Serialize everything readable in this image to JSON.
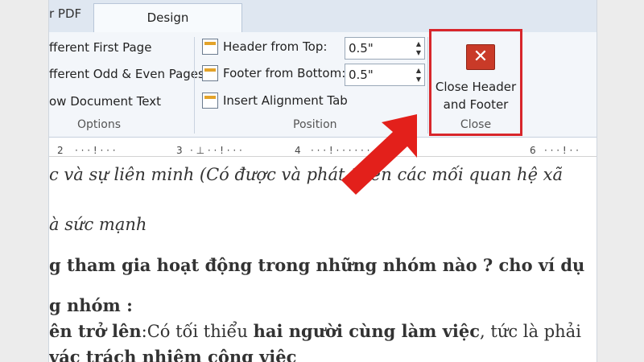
{
  "tabs": {
    "pdf": "r PDF",
    "design": "Design"
  },
  "options": {
    "items": [
      "fferent First Page",
      "fferent Odd & Even Pages",
      "ow Document Text"
    ],
    "label": "Options"
  },
  "position": {
    "header_from_top": "Header from Top:",
    "header_value": "0.5\"",
    "footer_from_bottom": "Footer from Bottom:",
    "footer_value": "0.5\"",
    "insert_alignment_tab": "Insert Alignment Tab",
    "label": "Position"
  },
  "close": {
    "button_line1": "Close Header",
    "button_line2": "and Footer",
    "label": "Close"
  },
  "ruler": [
    "2",
    "3",
    "4",
    "6"
  ],
  "document": {
    "line1": "c và sự liên minh (Có được và phát triển các mối quan hệ xã",
    "line2": "à sức mạnh",
    "line3": "g tham gia hoạt động trong những nhóm nào ? cho ví dụ",
    "line4": "g nhóm :",
    "line5_a": "ên trở lên",
    "line5_b": ":Có tối thiểu ",
    "line5_c": "hai người cùng làm việc",
    "line5_d": ", tức là phải",
    "line6": "vác trách nhiệm công việc"
  },
  "colors": {
    "highlight": "#d8262b",
    "arrow": "#e3201b",
    "close_icon": "#c93a28"
  }
}
